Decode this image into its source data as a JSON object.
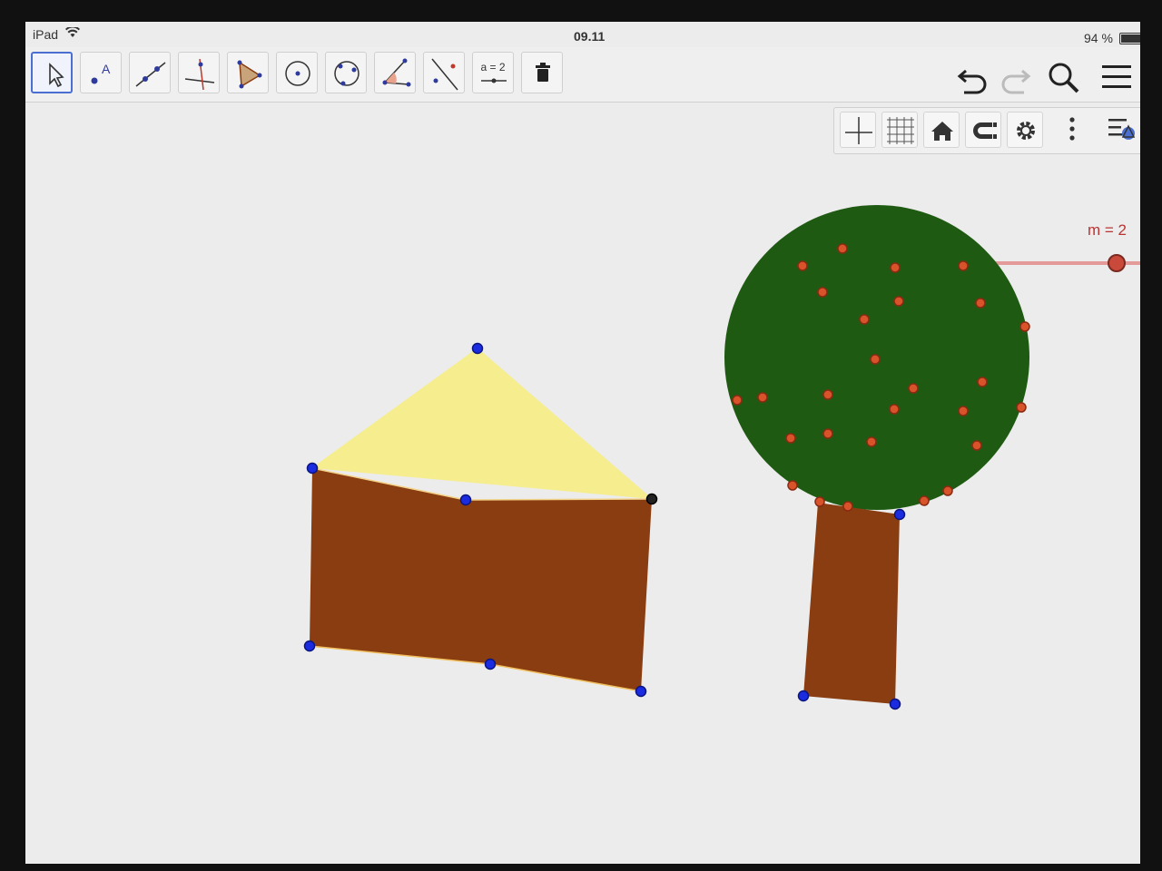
{
  "status": {
    "device": "iPad",
    "time": "09.11",
    "battery_text": "94 %",
    "battery_level": 0.94
  },
  "toolbar": {
    "tools": [
      {
        "name": "move",
        "selected": true
      },
      {
        "name": "point",
        "label": "A"
      },
      {
        "name": "line"
      },
      {
        "name": "perpendicular-line"
      },
      {
        "name": "polygon"
      },
      {
        "name": "circle-center-point"
      },
      {
        "name": "circle-three-points"
      },
      {
        "name": "angle"
      },
      {
        "name": "reflect"
      },
      {
        "name": "slider",
        "label": "a = 2"
      },
      {
        "name": "delete"
      }
    ],
    "right_icons": [
      "undo-icon",
      "redo-icon",
      "search-icon",
      "menu-icon"
    ]
  },
  "graphics_toolbar": {
    "icons": [
      "axes-icon",
      "grid-icon",
      "home-icon",
      "magnet-icon",
      "gear-icon",
      "more-vertical-icon",
      "style-bar-icon"
    ]
  },
  "slider": {
    "label": "m = 2",
    "value": 2
  },
  "colors": {
    "house_wall": "#8a3d10",
    "roof": "#f6ed8e",
    "tree_crown": "#1f5a12",
    "trunk": "#8a3d10",
    "apple": "#d9532a",
    "point_blue": "#1a2be0",
    "point_dark": "#222222",
    "slider_line": "#e59a9a",
    "slider_label": "#b33333"
  }
}
